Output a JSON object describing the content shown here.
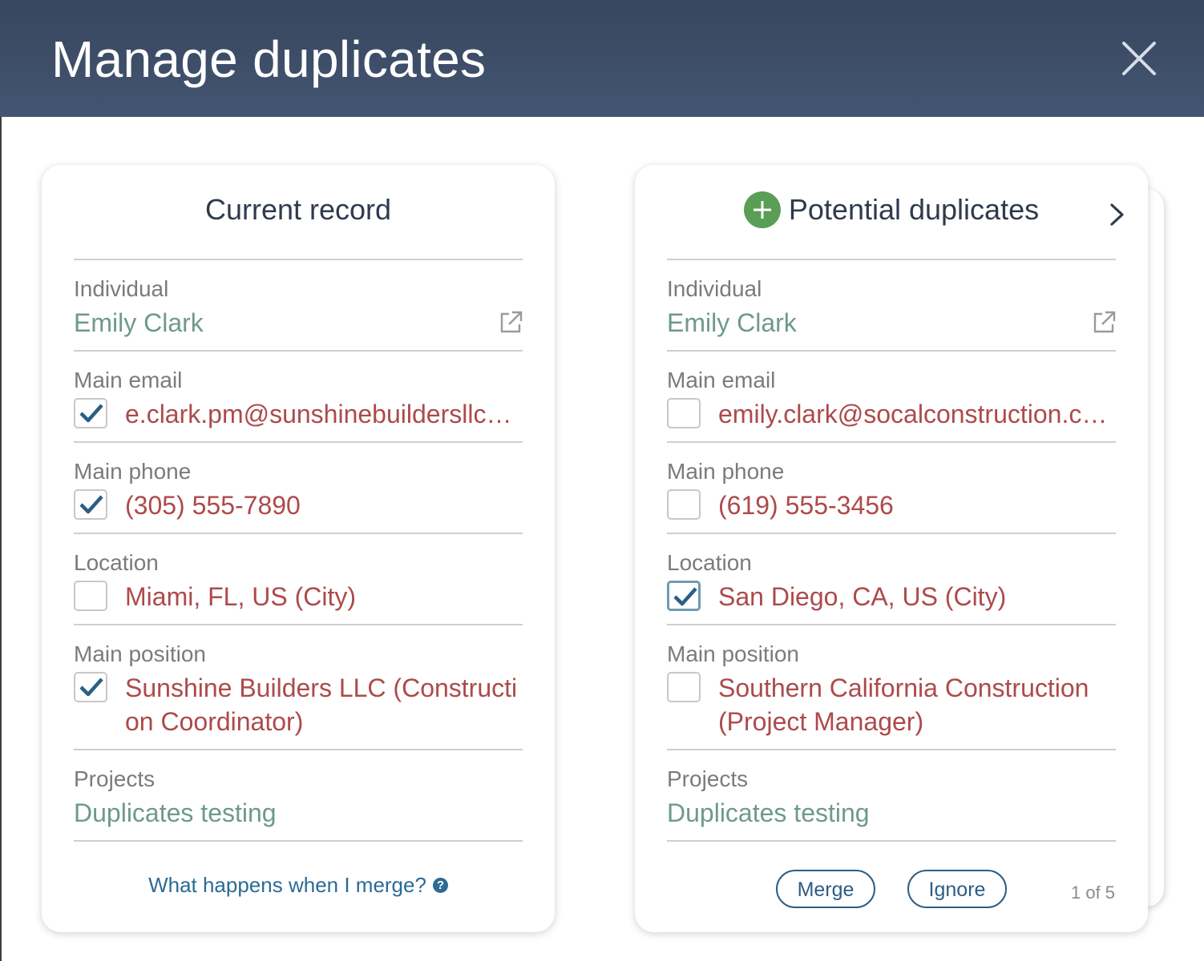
{
  "dialog": {
    "title": "Manage duplicates",
    "close_icon": "close-icon"
  },
  "current": {
    "title": "Current record",
    "individual": {
      "label": "Individual",
      "value": "Emily Clark",
      "icon": "external-link-icon"
    },
    "email": {
      "label": "Main email",
      "value": "e.clark.pm@sunshinebuildersllc.com",
      "checked": true
    },
    "phone": {
      "label": "Main phone",
      "value": "(305) 555-7890",
      "checked": true
    },
    "location": {
      "label": "Location",
      "value": "Miami, FL, US (City)",
      "checked": false
    },
    "position": {
      "label": "Main position",
      "value": "Sunshine Builders LLC (Construction Coordinator)",
      "checked": true
    },
    "projects": {
      "label": "Projects",
      "value": "Duplicates testing"
    },
    "help_link": "What happens when I merge?",
    "help_icon": "?"
  },
  "duplicate": {
    "title": "Potential duplicates",
    "individual": {
      "label": "Individual",
      "value": "Emily Clark",
      "icon": "external-link-icon"
    },
    "email": {
      "label": "Main email",
      "value": "emily.clark@socalconstruction.com",
      "checked": false
    },
    "phone": {
      "label": "Main phone",
      "value": "(619) 555-3456",
      "checked": false
    },
    "location": {
      "label": "Location",
      "value": "San Diego, CA, US (City)",
      "checked": true
    },
    "position": {
      "label": "Main position",
      "value": "Southern California Construction (Project Manager)",
      "checked": false
    },
    "projects": {
      "label": "Projects",
      "value": "Duplicates testing"
    },
    "merge_label": "Merge",
    "ignore_label": "Ignore",
    "pager": "1 of 5"
  },
  "colors": {
    "header": "#3d4b63",
    "link_green": "#6e9a89",
    "value_red": "#ad4a4b",
    "accent_blue": "#2c5d85",
    "plus_green": "#5a9e55"
  }
}
